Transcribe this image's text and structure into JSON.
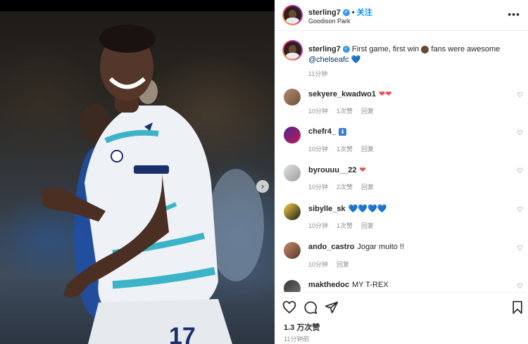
{
  "post": {
    "username": "sterling7",
    "follow_label": "关注",
    "location": "Goodison Park",
    "more_icon": "more-dots-icon",
    "image_next_icon": "chevron-right-icon"
  },
  "caption": {
    "username": "sterling7",
    "text": "First game, first win",
    "text_after": "fans were awesome",
    "mention": "@chelseafc",
    "time": "11分钟"
  },
  "comments": [
    {
      "username": "sekyere_kwadwo1",
      "text": "",
      "emoji": "❤❤",
      "emoji_color": "#ed4956",
      "time": "10分钟",
      "likes": "1次赞",
      "reply": "回复"
    },
    {
      "username": "chefr4_",
      "text": "",
      "emoji": "⬇",
      "emoji_color": "#3a7bd5",
      "time": "10分钟",
      "likes": "1次赞",
      "reply": "回复"
    },
    {
      "username": "byrouuu__22",
      "text": "",
      "emoji": "❤",
      "emoji_color": "#ed4956",
      "time": "10分钟",
      "likes": "2次赞",
      "reply": "回复"
    },
    {
      "username": "sibylle_sk",
      "text": "",
      "emoji": "💙💙💙💙",
      "emoji_color": "#3a7bd5",
      "time": "10分钟",
      "likes": "1次赞",
      "reply": "回复"
    },
    {
      "username": "ando_castro",
      "text": "Jogar muito !!",
      "emoji": "",
      "emoji_color": "#262626",
      "time": "10分钟",
      "likes": "",
      "reply": "回复"
    },
    {
      "username": "makthedoc",
      "text": "MY T-REX",
      "emoji": "",
      "emoji_color": "#262626",
      "time": "",
      "likes": "",
      "reply": ""
    }
  ],
  "footer": {
    "likes": "1.3 万次赞",
    "time": "11分钟前"
  },
  "colors": {
    "accent": "#0095f6",
    "verified": "#3897f0",
    "heart_red": "#ed4956"
  }
}
